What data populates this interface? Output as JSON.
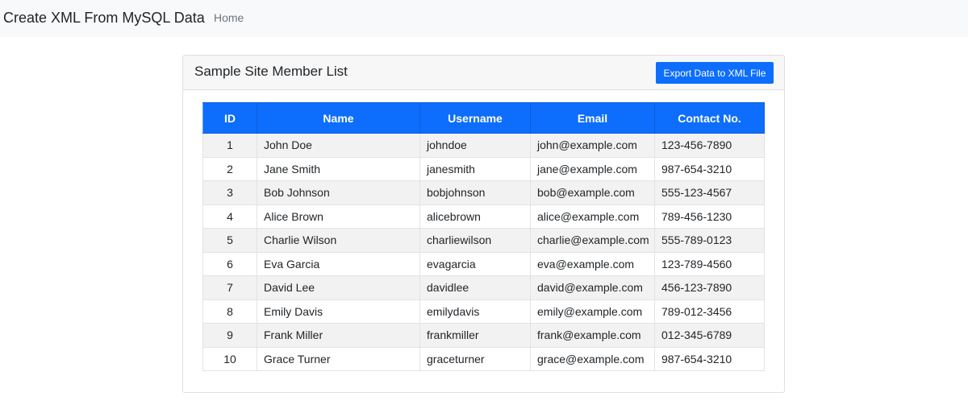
{
  "navbar": {
    "brand": "Create XML From MySQL Data",
    "home_link": "Home"
  },
  "card": {
    "title": "Sample Site Member List",
    "export_button": "Export Data to XML File"
  },
  "table": {
    "headers": [
      "ID",
      "Name",
      "Username",
      "Email",
      "Contact No."
    ],
    "rows": [
      [
        "1",
        "John Doe",
        "johndoe",
        "john@example.com",
        "123-456-7890"
      ],
      [
        "2",
        "Jane Smith",
        "janesmith",
        "jane@example.com",
        "987-654-3210"
      ],
      [
        "3",
        "Bob Johnson",
        "bobjohnson",
        "bob@example.com",
        "555-123-4567"
      ],
      [
        "4",
        "Alice Brown",
        "alicebrown",
        "alice@example.com",
        "789-456-1230"
      ],
      [
        "5",
        "Charlie Wilson",
        "charliewilson",
        "charlie@example.com",
        "555-789-0123"
      ],
      [
        "6",
        "Eva Garcia",
        "evagarcia",
        "eva@example.com",
        "123-789-4560"
      ],
      [
        "7",
        "David Lee",
        "davidlee",
        "david@example.com",
        "456-123-7890"
      ],
      [
        "8",
        "Emily Davis",
        "emilydavis",
        "emily@example.com",
        "789-012-3456"
      ],
      [
        "9",
        "Frank Miller",
        "frankmiller",
        "frank@example.com",
        "012-345-6789"
      ],
      [
        "10",
        "Grace Turner",
        "graceturner",
        "grace@example.com",
        "987-654-3210"
      ]
    ]
  },
  "colors": {
    "primary": "#0d6efd",
    "navbar_bg": "#f8f9fa",
    "stripe": "#f2f2f2"
  }
}
